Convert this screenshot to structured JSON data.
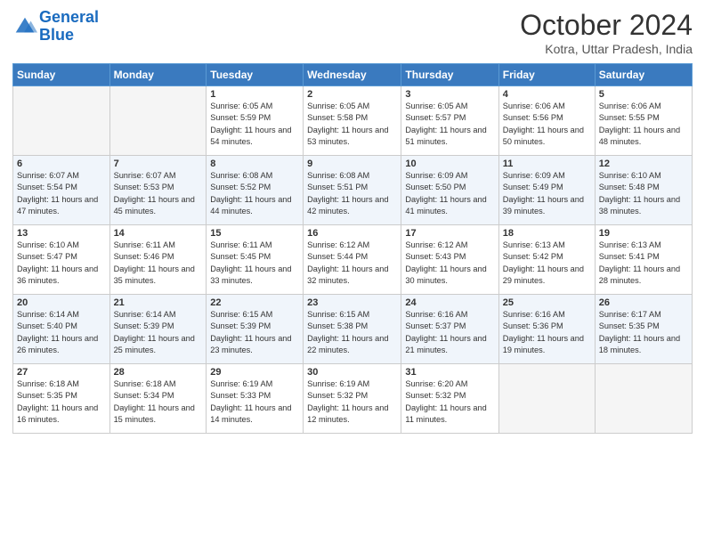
{
  "header": {
    "logo_line1": "General",
    "logo_line2": "Blue",
    "month": "October 2024",
    "location": "Kotra, Uttar Pradesh, India"
  },
  "weekdays": [
    "Sunday",
    "Monday",
    "Tuesday",
    "Wednesday",
    "Thursday",
    "Friday",
    "Saturday"
  ],
  "weeks": [
    [
      {
        "day": "",
        "empty": true
      },
      {
        "day": "",
        "empty": true
      },
      {
        "day": "1",
        "sunrise": "6:05 AM",
        "sunset": "5:59 PM",
        "daylight": "11 hours and 54 minutes."
      },
      {
        "day": "2",
        "sunrise": "6:05 AM",
        "sunset": "5:58 PM",
        "daylight": "11 hours and 53 minutes."
      },
      {
        "day": "3",
        "sunrise": "6:05 AM",
        "sunset": "5:57 PM",
        "daylight": "11 hours and 51 minutes."
      },
      {
        "day": "4",
        "sunrise": "6:06 AM",
        "sunset": "5:56 PM",
        "daylight": "11 hours and 50 minutes."
      },
      {
        "day": "5",
        "sunrise": "6:06 AM",
        "sunset": "5:55 PM",
        "daylight": "11 hours and 48 minutes."
      }
    ],
    [
      {
        "day": "6",
        "sunrise": "6:07 AM",
        "sunset": "5:54 PM",
        "daylight": "11 hours and 47 minutes."
      },
      {
        "day": "7",
        "sunrise": "6:07 AM",
        "sunset": "5:53 PM",
        "daylight": "11 hours and 45 minutes."
      },
      {
        "day": "8",
        "sunrise": "6:08 AM",
        "sunset": "5:52 PM",
        "daylight": "11 hours and 44 minutes."
      },
      {
        "day": "9",
        "sunrise": "6:08 AM",
        "sunset": "5:51 PM",
        "daylight": "11 hours and 42 minutes."
      },
      {
        "day": "10",
        "sunrise": "6:09 AM",
        "sunset": "5:50 PM",
        "daylight": "11 hours and 41 minutes."
      },
      {
        "day": "11",
        "sunrise": "6:09 AM",
        "sunset": "5:49 PM",
        "daylight": "11 hours and 39 minutes."
      },
      {
        "day": "12",
        "sunrise": "6:10 AM",
        "sunset": "5:48 PM",
        "daylight": "11 hours and 38 minutes."
      }
    ],
    [
      {
        "day": "13",
        "sunrise": "6:10 AM",
        "sunset": "5:47 PM",
        "daylight": "11 hours and 36 minutes."
      },
      {
        "day": "14",
        "sunrise": "6:11 AM",
        "sunset": "5:46 PM",
        "daylight": "11 hours and 35 minutes."
      },
      {
        "day": "15",
        "sunrise": "6:11 AM",
        "sunset": "5:45 PM",
        "daylight": "11 hours and 33 minutes."
      },
      {
        "day": "16",
        "sunrise": "6:12 AM",
        "sunset": "5:44 PM",
        "daylight": "11 hours and 32 minutes."
      },
      {
        "day": "17",
        "sunrise": "6:12 AM",
        "sunset": "5:43 PM",
        "daylight": "11 hours and 30 minutes."
      },
      {
        "day": "18",
        "sunrise": "6:13 AM",
        "sunset": "5:42 PM",
        "daylight": "11 hours and 29 minutes."
      },
      {
        "day": "19",
        "sunrise": "6:13 AM",
        "sunset": "5:41 PM",
        "daylight": "11 hours and 28 minutes."
      }
    ],
    [
      {
        "day": "20",
        "sunrise": "6:14 AM",
        "sunset": "5:40 PM",
        "daylight": "11 hours and 26 minutes."
      },
      {
        "day": "21",
        "sunrise": "6:14 AM",
        "sunset": "5:39 PM",
        "daylight": "11 hours and 25 minutes."
      },
      {
        "day": "22",
        "sunrise": "6:15 AM",
        "sunset": "5:39 PM",
        "daylight": "11 hours and 23 minutes."
      },
      {
        "day": "23",
        "sunrise": "6:15 AM",
        "sunset": "5:38 PM",
        "daylight": "11 hours and 22 minutes."
      },
      {
        "day": "24",
        "sunrise": "6:16 AM",
        "sunset": "5:37 PM",
        "daylight": "11 hours and 21 minutes."
      },
      {
        "day": "25",
        "sunrise": "6:16 AM",
        "sunset": "5:36 PM",
        "daylight": "11 hours and 19 minutes."
      },
      {
        "day": "26",
        "sunrise": "6:17 AM",
        "sunset": "5:35 PM",
        "daylight": "11 hours and 18 minutes."
      }
    ],
    [
      {
        "day": "27",
        "sunrise": "6:18 AM",
        "sunset": "5:35 PM",
        "daylight": "11 hours and 16 minutes."
      },
      {
        "day": "28",
        "sunrise": "6:18 AM",
        "sunset": "5:34 PM",
        "daylight": "11 hours and 15 minutes."
      },
      {
        "day": "29",
        "sunrise": "6:19 AM",
        "sunset": "5:33 PM",
        "daylight": "11 hours and 14 minutes."
      },
      {
        "day": "30",
        "sunrise": "6:19 AM",
        "sunset": "5:32 PM",
        "daylight": "11 hours and 12 minutes."
      },
      {
        "day": "31",
        "sunrise": "6:20 AM",
        "sunset": "5:32 PM",
        "daylight": "11 hours and 11 minutes."
      },
      {
        "day": "",
        "empty": true
      },
      {
        "day": "",
        "empty": true
      }
    ]
  ]
}
